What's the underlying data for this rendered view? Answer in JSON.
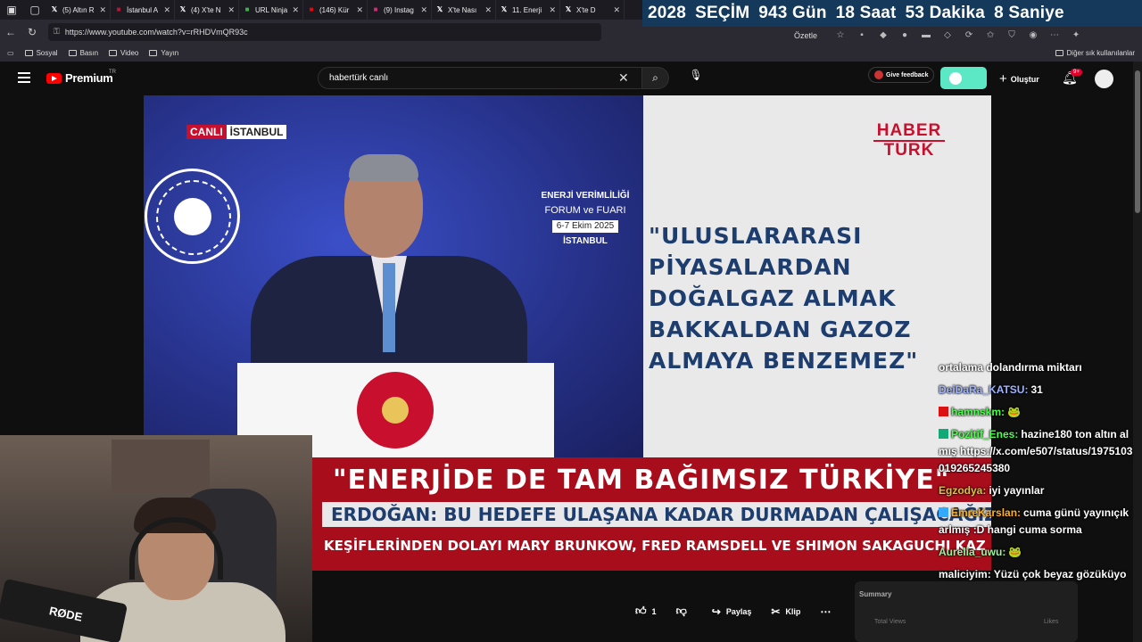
{
  "browser": {
    "tabs": [
      {
        "icon": "x-icon",
        "label": "(5) Altın R",
        "color": "#ffffff"
      },
      {
        "icon": "haberturk-icon",
        "label": "İstanbul A",
        "color": "#c8102e"
      },
      {
        "icon": "x-icon",
        "label": "(4) X'te N",
        "color": "#ffffff"
      },
      {
        "icon": "url-ninja-icon",
        "label": "URL Ninja",
        "color": "#3cb44b"
      },
      {
        "icon": "youtube-icon",
        "label": "(146) Kür",
        "color": "#ff0000"
      },
      {
        "icon": "instagram-icon",
        "label": "(9) Instag",
        "color": "#d62976"
      },
      {
        "icon": "x-icon",
        "label": "X'te Nası",
        "color": "#ffffff"
      },
      {
        "icon": "x-icon",
        "label": "11. Enerji",
        "color": "#ffffff"
      },
      {
        "icon": "x-icon",
        "label": "X'te D",
        "color": "#ffffff"
      }
    ],
    "url": "https://www.youtube.com/watch?v=rRHDVmQR93c",
    "summarize_label": "Özetle",
    "bookmarks": [
      "Sosyal",
      "Basın",
      "Video",
      "Yayın"
    ],
    "other_bookmarks": "Diğer sık kullanılanlar"
  },
  "countdown": {
    "year": "2028",
    "label": "SEÇİM",
    "days": "943 Gün",
    "hours": "18 Saat",
    "minutes": "53 Dakika",
    "seconds": "8 Saniye"
  },
  "youtube": {
    "brand": "Premium",
    "region": "TR",
    "search_value": "habertürk canlı",
    "feedback_label": "Give feedback",
    "create_label": "Oluştur",
    "notif_count": "9+"
  },
  "video": {
    "live_label": "CANLI",
    "location_label": "İSTANBUL",
    "event_line1": "ENERJİ VERİMLİLİĞİ",
    "event_line2": "FORUM ve FUARI",
    "event_date": "6-7 Ekim 2025",
    "event_city": "İSTANBUL",
    "channel_logo_top": "HABER",
    "channel_logo_bottom": "TÜRK",
    "quote": "\"ULUSLARARASI\nPİYASALARDAN\nDOĞALGAZ ALMAK\nBAKKALDAN GAZOZ\nALMAYA BENZEMEZ\"",
    "headline": "\"ENERJİDE DE TAM BAĞIMSIZ TÜRKİYE\"",
    "subheadline": "ERDOĞAN: BU HEDEFE ULAŞANA KADAR DURMADAN ÇALIŞACAĞIZ",
    "ticker": "KEŞİFLERİNDEN DOLAYI MARY BRUNKOW, FRED RAMSDELL VE SHIMON SAKAGUCHI KAZ"
  },
  "actions": {
    "like_count": "1",
    "share_label": "Paylaş",
    "clip_label": "Klip",
    "summary_title": "Summary",
    "total_views_label": "Total Views",
    "likes_label": "Likes"
  },
  "webcam": {
    "mic_brand": "RØDE"
  },
  "chat": [
    {
      "user": "",
      "text": "ortalama dolandırma miktarı",
      "user_color": "#ffffff",
      "badge": ""
    },
    {
      "user": "DeiDaRa_KATSU:",
      "text": "31",
      "user_color": "#9fb4ff",
      "badge": ""
    },
    {
      "user": "hamnskm:",
      "text": "🐸",
      "user_color": "#4cff4c",
      "badge": "#d11"
    },
    {
      "user": "Pozitif_Enes:",
      "text": "hazine180 ton altın almış https://x.com/e507/status/1975103019265245380",
      "user_color": "#4cff4c",
      "badge": "#1a7"
    },
    {
      "user": "Egzodya:",
      "text": "iyi yayınlar",
      "user_color": "#d9c14a",
      "badge": ""
    },
    {
      "user": "EmreKarslan:",
      "text": "cuma günü yayınıçıkarlmış :D hangi cuma sorma",
      "user_color": "#ffb020",
      "badge": "#3af"
    },
    {
      "user": "Aurelia_uwu:",
      "text": "🐸",
      "user_color": "#9ff29f",
      "badge": ""
    },
    {
      "user": "maliciyim:",
      "text": "Yüzü çok beyaz gözüküyo",
      "user_color": "#ffffff",
      "badge": ""
    }
  ]
}
